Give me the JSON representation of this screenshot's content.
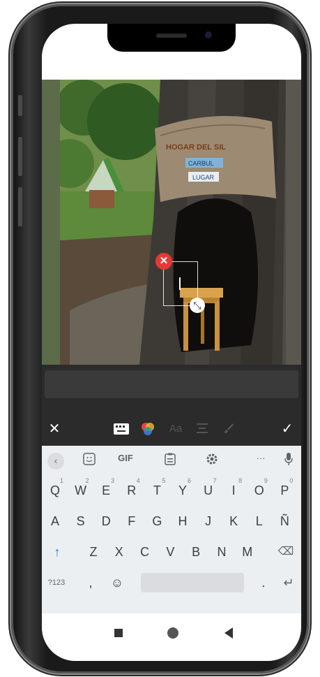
{
  "photo": {
    "sign_lines": [
      "HOGAR DEL SIL",
      "CARBUL",
      "LUGAR"
    ]
  },
  "editor": {
    "delete_icon": "✕",
    "resize_icon": "⤡"
  },
  "toolbar": {
    "close_icon": "✕",
    "keyboard_icon": "keyboard-icon",
    "font_label": "Aa",
    "confirm_icon": "✓"
  },
  "suggestions": {
    "back": "‹",
    "gif": "GIF",
    "more": "···"
  },
  "keyboard": {
    "row1": [
      {
        "k": "Q",
        "h": "1"
      },
      {
        "k": "W",
        "h": "2"
      },
      {
        "k": "E",
        "h": "3"
      },
      {
        "k": "R",
        "h": "4"
      },
      {
        "k": "T",
        "h": "5"
      },
      {
        "k": "Y",
        "h": "6"
      },
      {
        "k": "U",
        "h": "7"
      },
      {
        "k": "I",
        "h": "8"
      },
      {
        "k": "O",
        "h": "9"
      },
      {
        "k": "P",
        "h": "0"
      }
    ],
    "row2": [
      "A",
      "S",
      "D",
      "F",
      "G",
      "H",
      "J",
      "K",
      "L",
      "Ñ"
    ],
    "row3": [
      "Z",
      "X",
      "C",
      "V",
      "B",
      "N",
      "M"
    ],
    "shift": "↑",
    "backspace": "⌫",
    "symbols": "?123",
    "comma": ",",
    "emoji": "☺",
    "period": ".",
    "enter": "↵"
  },
  "colors": {
    "accent": "#1a73e8",
    "delete": "#e53935"
  }
}
